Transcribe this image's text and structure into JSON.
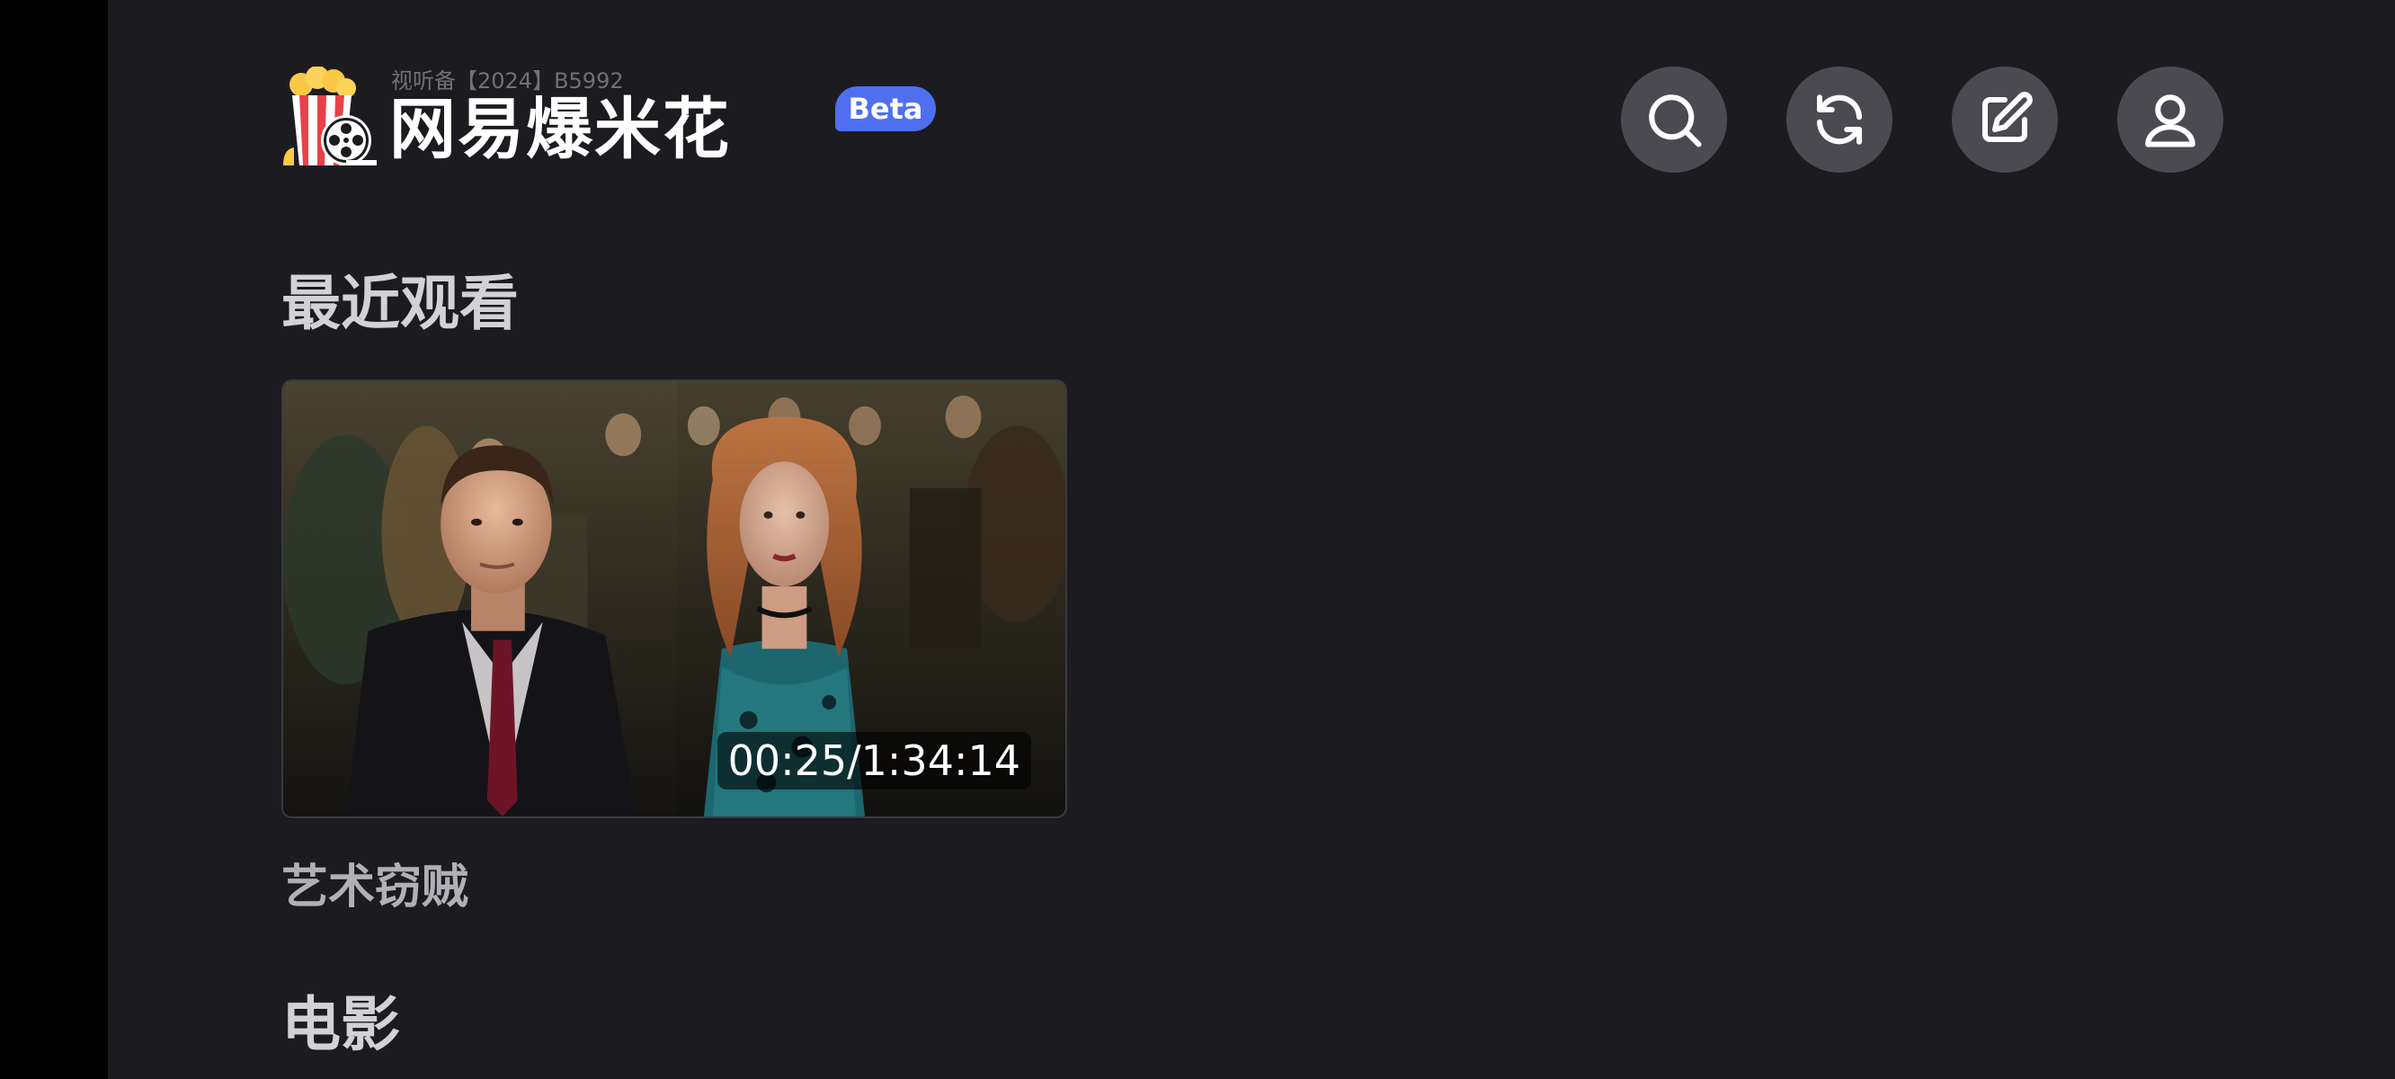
{
  "header": {
    "license_text": "视听备【2024】B5992",
    "brand_name": "网易爆米花",
    "beta_label": "Beta",
    "actions": [
      {
        "name": "search",
        "icon": "search-icon"
      },
      {
        "name": "refresh",
        "icon": "refresh-icon"
      },
      {
        "name": "edit",
        "icon": "edit-icon"
      },
      {
        "name": "profile",
        "icon": "user-icon"
      }
    ]
  },
  "recent": {
    "title": "最近观看",
    "items": [
      {
        "title": "艺术窃贼",
        "progress_text": "00:25/1:34:14",
        "thumbnail": "man-and-woman-in-front-of-painting"
      }
    ]
  },
  "movies": {
    "title": "电影"
  },
  "colors": {
    "background": "#1c1c20",
    "accent": "#4f6ff0",
    "icon_button_bg": "#4a4a50",
    "title_text": "#d2d2d6"
  }
}
